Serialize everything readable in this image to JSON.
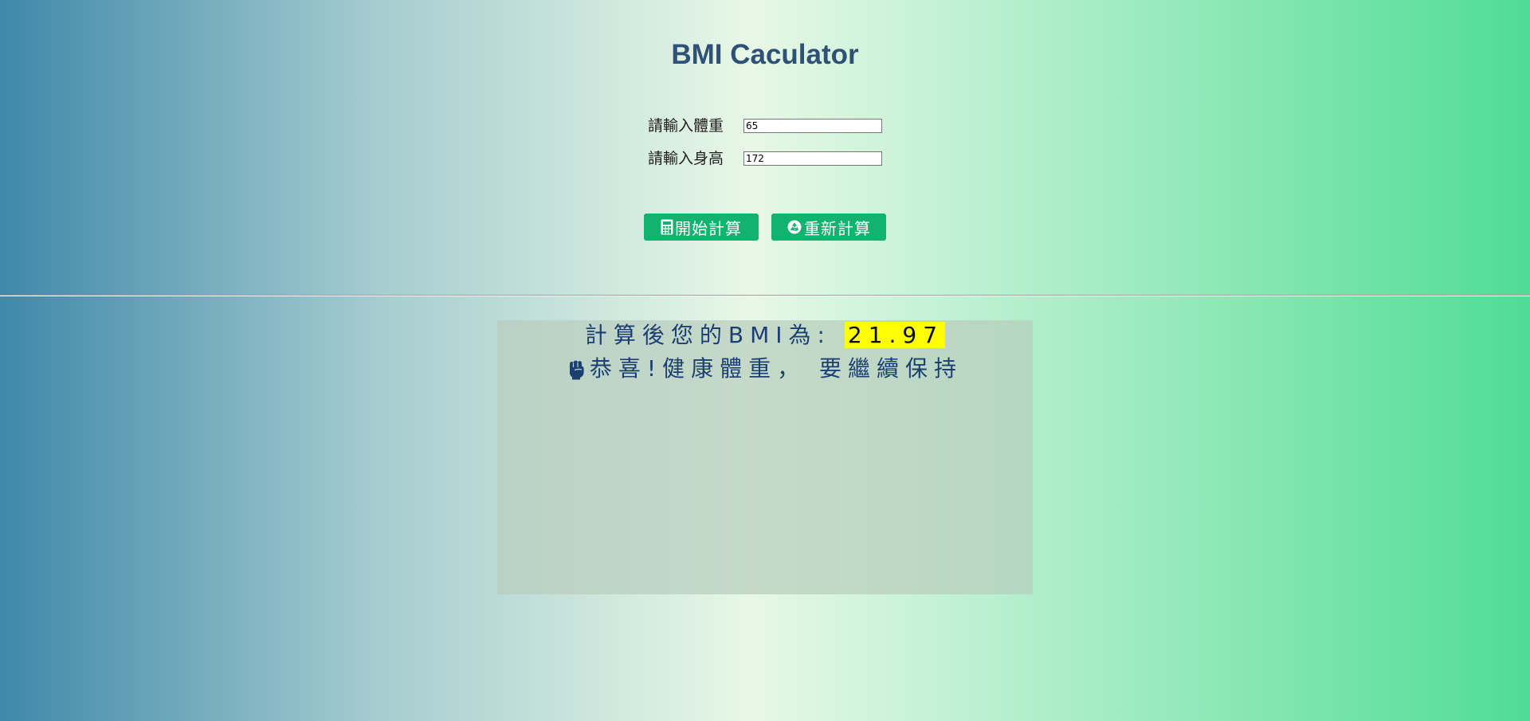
{
  "page": {
    "title": "BMI Caculator"
  },
  "form": {
    "weight_label": "請輸入體重",
    "weight_value": "65",
    "height_label": "請輸入身高",
    "height_value": "172"
  },
  "buttons": {
    "calculate_label": "開始計算",
    "calculate_icon": "calculator-icon",
    "reset_label": "重新計算",
    "reset_icon": "recycle-icon"
  },
  "result": {
    "prefix": "計算後您的BMI為:",
    "bmi_value": "21.97",
    "message": "恭喜!健康體重， 要繼續保持",
    "message_icon": "fist-icon"
  },
  "colors": {
    "title": "#2e5175",
    "button_bg": "#12b26f",
    "result_text": "#1c3f72",
    "bmi_highlight": "#ffff00"
  }
}
